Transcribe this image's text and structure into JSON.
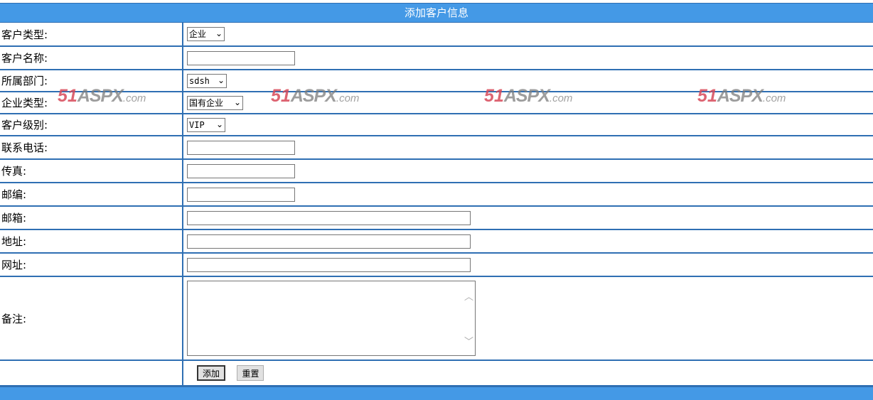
{
  "header": {
    "title": "添加客户信息"
  },
  "colors": {
    "bar_blue": "#4499e6",
    "border_blue": "#2f6fb3",
    "watermark_red": "#d84a5a"
  },
  "watermark": {
    "num": "51",
    "brand": "ASPX",
    "domain": ".com"
  },
  "form": {
    "customer_type": {
      "label": "客户类型:",
      "value": "企业"
    },
    "customer_name": {
      "label": "客户名称:",
      "value": ""
    },
    "department": {
      "label": "所属部门:",
      "value": "sdsh"
    },
    "enterprise_type": {
      "label": "企业类型:",
      "value": "国有企业"
    },
    "customer_level": {
      "label": "客户级别:",
      "value": "VIP"
    },
    "phone": {
      "label": "联系电话:",
      "value": ""
    },
    "fax": {
      "label": "传真:",
      "value": ""
    },
    "postcode": {
      "label": "邮编:",
      "value": ""
    },
    "email": {
      "label": "邮箱:",
      "value": ""
    },
    "address": {
      "label": "地址:",
      "value": ""
    },
    "website": {
      "label": "网址:",
      "value": ""
    },
    "remarks": {
      "label": "备注:",
      "value": ""
    }
  },
  "buttons": {
    "add_label": "添加",
    "reset_label": "重置"
  },
  "icons": {
    "select_arrow": "chevron-down-icon",
    "scroll_up": "chevron-up-icon",
    "scroll_down": "chevron-down-icon"
  }
}
